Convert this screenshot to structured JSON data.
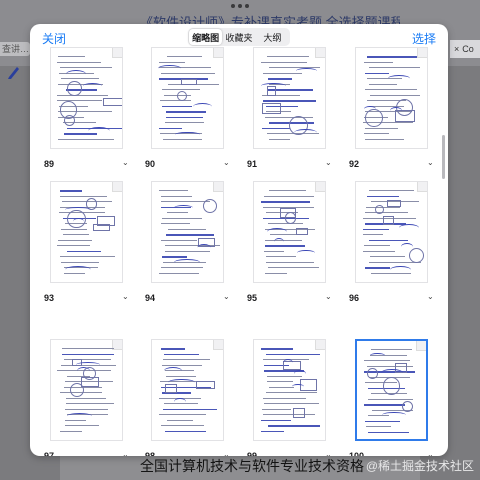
{
  "background": {
    "title": "《软件设计师》专补课真实考题 全选择题课程",
    "search_text": "查讲…",
    "tab_label": "Co",
    "footer_text": "全国计算机技术与软件专业技术资格（水平）考试",
    "watermark": "@稀土掘金技术社区"
  },
  "sheet": {
    "close_label": "关闭",
    "select_label": "选择",
    "segments": [
      "缩略图",
      "收藏夹",
      "大纲"
    ],
    "active_segment": 0
  },
  "thumbnails": [
    {
      "page": "89"
    },
    {
      "page": "90"
    },
    {
      "page": "91"
    },
    {
      "page": "92"
    },
    {
      "page": "93"
    },
    {
      "page": "94"
    },
    {
      "page": "95"
    },
    {
      "page": "96"
    },
    {
      "page": "97"
    },
    {
      "page": "98"
    },
    {
      "page": "99"
    },
    {
      "page": "100",
      "selected": true
    }
  ],
  "colors": {
    "accent": "#1a7cf5",
    "selection": "#2f7bea",
    "ink": "#3b47b5"
  },
  "icons": [
    "pen-icon",
    "chevron-down-icon",
    "close-icon",
    "more-dots-icon"
  ]
}
